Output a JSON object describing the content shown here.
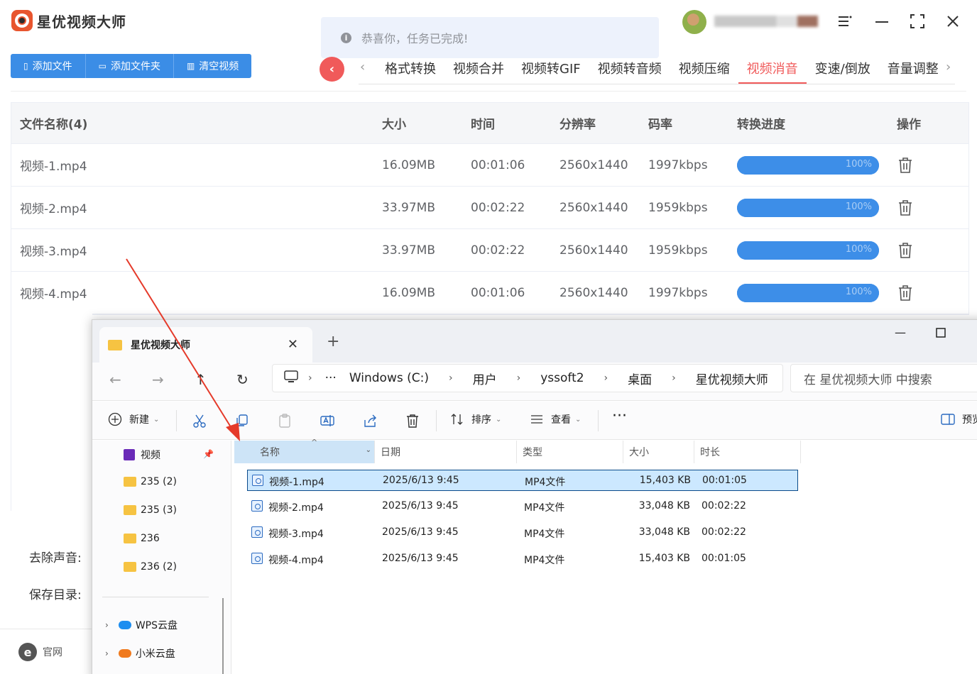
{
  "app": {
    "title": "星优视频大师",
    "toast": "恭喜你，任务已完成!"
  },
  "toolbar": {
    "add_file": "添加文件",
    "add_folder": "添加文件夹",
    "clear": "清空视频"
  },
  "tabs": [
    "格式转换",
    "视频合并",
    "视频转GIF",
    "视频转音频",
    "视频压缩",
    "视频消音",
    "变速/倒放",
    "音量调整"
  ],
  "active_tab": "视频消音",
  "table": {
    "headers": [
      "文件名称(4)",
      "大小",
      "时间",
      "分辨率",
      "码率",
      "转换进度",
      "操作"
    ],
    "rows": [
      {
        "name": "视频-1.mp4",
        "size": "16.09MB",
        "time": "00:01:06",
        "res": "2560x1440",
        "bitrate": "1997kbps",
        "progress": 100,
        "progress_label": "100%"
      },
      {
        "name": "视频-2.mp4",
        "size": "33.97MB",
        "time": "00:02:22",
        "res": "2560x1440",
        "bitrate": "1959kbps",
        "progress": 100,
        "progress_label": "100%"
      },
      {
        "name": "视频-3.mp4",
        "size": "33.97MB",
        "time": "00:02:22",
        "res": "2560x1440",
        "bitrate": "1959kbps",
        "progress": 100,
        "progress_label": "100%"
      },
      {
        "name": "视频-4.mp4",
        "size": "16.09MB",
        "time": "00:01:06",
        "res": "2560x1440",
        "bitrate": "1997kbps",
        "progress": 100,
        "progress_label": "100%"
      }
    ]
  },
  "options": {
    "remove_audio_label": "去除声音:",
    "save_dir_label": "保存目录:"
  },
  "footer": {
    "official": "官网"
  },
  "explorer": {
    "tab_title": "星优视频大师",
    "breadcrumb": [
      "Windows (C:)",
      "用户",
      "yssoft2",
      "桌面",
      "星优视频大师"
    ],
    "search_placeholder": "在 星优视频大师 中搜索",
    "toolbar": {
      "new": "新建",
      "sort": "排序",
      "view": "查看",
      "preview": "预览"
    },
    "sidebar": {
      "pinned": "视频",
      "folders": [
        "235 (2)",
        "235 (3)",
        "236",
        "236 (2)"
      ],
      "cloud": [
        "WPS云盘",
        "小米云盘"
      ]
    },
    "columns": [
      "名称",
      "日期",
      "类型",
      "大小",
      "时长"
    ],
    "files": [
      {
        "name": "视频-1.mp4",
        "date": "2025/6/13 9:45",
        "type": "MP4文件",
        "size": "15,403 KB",
        "duration": "00:01:05",
        "selected": true
      },
      {
        "name": "视频-2.mp4",
        "date": "2025/6/13 9:45",
        "type": "MP4文件",
        "size": "33,048 KB",
        "duration": "00:02:22",
        "selected": false
      },
      {
        "name": "视频-3.mp4",
        "date": "2025/6/13 9:45",
        "type": "MP4文件",
        "size": "33,048 KB",
        "duration": "00:02:22",
        "selected": false
      },
      {
        "name": "视频-4.mp4",
        "date": "2025/6/13 9:45",
        "type": "MP4文件",
        "size": "15,403 KB",
        "duration": "00:01:05",
        "selected": false
      }
    ]
  },
  "colors": {
    "accent_blue": "#3b8de6",
    "accent_red": "#f05a5a",
    "selection": "#cce8ff",
    "arrow": "#e53a2a"
  }
}
